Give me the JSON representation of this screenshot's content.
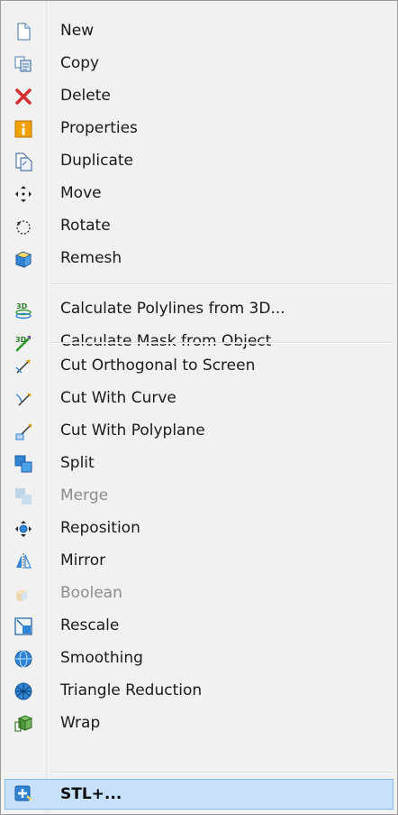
{
  "menu": {
    "groups": [
      {
        "items": [
          {
            "label": "New",
            "icon": "new-page-icon"
          },
          {
            "label": "Copy",
            "icon": "copy-icon"
          },
          {
            "label": "Delete",
            "icon": "delete-x-icon",
            "color": "#d32f2f"
          },
          {
            "label": "Properties",
            "icon": "info-icon",
            "color": "#f0a000"
          },
          {
            "label": "Duplicate",
            "icon": "duplicate-icon"
          },
          {
            "label": "Move",
            "icon": "move-arrows-icon"
          },
          {
            "label": "Rotate",
            "icon": "rotate-icon"
          },
          {
            "label": "Remesh",
            "icon": "remesh-cube-icon",
            "color": "#2f84d6"
          }
        ]
      },
      {
        "items": [
          {
            "label": "Calculate Polylines from 3D...",
            "icon": "polylines-3d-icon"
          },
          {
            "label": "Calculate Mask from Object",
            "icon": "mask-3d-icon"
          }
        ]
      },
      {
        "items": [
          {
            "label": "Cut Orthogonal to Screen",
            "icon": "cut-orthogonal-icon"
          },
          {
            "label": "Cut With Curve",
            "icon": "cut-curve-icon"
          },
          {
            "label": "Cut With Polyplane",
            "icon": "cut-polyplane-icon"
          },
          {
            "label": "Split",
            "icon": "split-icon"
          },
          {
            "label": "Merge",
            "icon": "merge-icon",
            "disabled": true
          },
          {
            "label": "Reposition",
            "icon": "reposition-icon"
          },
          {
            "label": "Mirror",
            "icon": "mirror-icon"
          },
          {
            "label": "Boolean",
            "icon": "boolean-icon",
            "disabled": true
          },
          {
            "label": "Rescale",
            "icon": "rescale-icon"
          },
          {
            "label": "Smoothing",
            "icon": "smoothing-icon"
          },
          {
            "label": "Triangle Reduction",
            "icon": "triangle-reduction-icon"
          },
          {
            "label": "Wrap",
            "icon": "wrap-icon"
          }
        ]
      },
      {
        "items": [
          {
            "label": "STL+...",
            "icon": "stl-plus-icon",
            "highlighted": true
          }
        ]
      }
    ]
  },
  "colors": {
    "menu_bg": "#f1f1f1",
    "highlight_bg": "#c6e1f9",
    "highlight_border": "#86b9e8",
    "disabled_text": "#8c8c8c",
    "accent_blue": "#2f84d6"
  }
}
